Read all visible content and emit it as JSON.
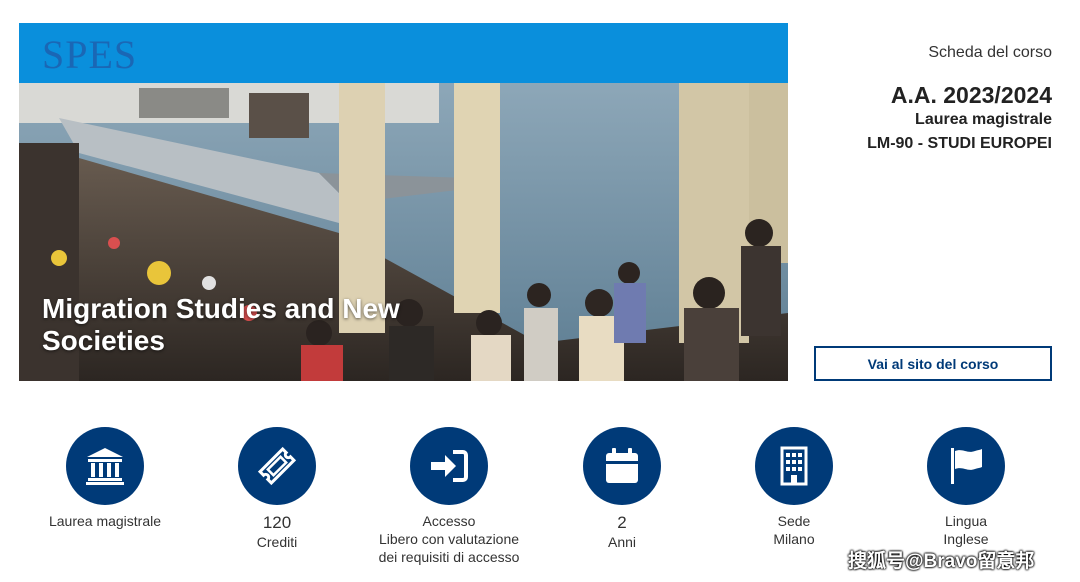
{
  "hero": {
    "logo": "SPES",
    "title": "Migration Studies and New Societies"
  },
  "panel": {
    "subtitle": "Scheda del corso",
    "year": "A.A. 2023/2024",
    "degree": "Laurea magistrale",
    "code": "LM-90 - STUDI EUROPEI",
    "button_label": "Vai al sito del corso"
  },
  "features": [
    {
      "icon": "university-icon",
      "line1": "Laurea magistrale"
    },
    {
      "icon": "ticket-icon",
      "line1": "120",
      "line2": "Crediti"
    },
    {
      "icon": "sign-in-icon",
      "line1": "Accesso",
      "line2": "Libero con valutazione",
      "line3": "dei requisiti di accesso"
    },
    {
      "icon": "calendar-icon",
      "line1": "2",
      "line2": "Anni"
    },
    {
      "icon": "building-icon",
      "line1": "Sede",
      "line2": "Milano"
    },
    {
      "icon": "flag-icon",
      "line1": "Lingua",
      "line2": "Inglese"
    }
  ],
  "watermark": "搜狐号@Bravo留意邦",
  "colors": {
    "brand_blue": "#0a8fdc",
    "navy": "#003a78",
    "text": "#333333"
  }
}
